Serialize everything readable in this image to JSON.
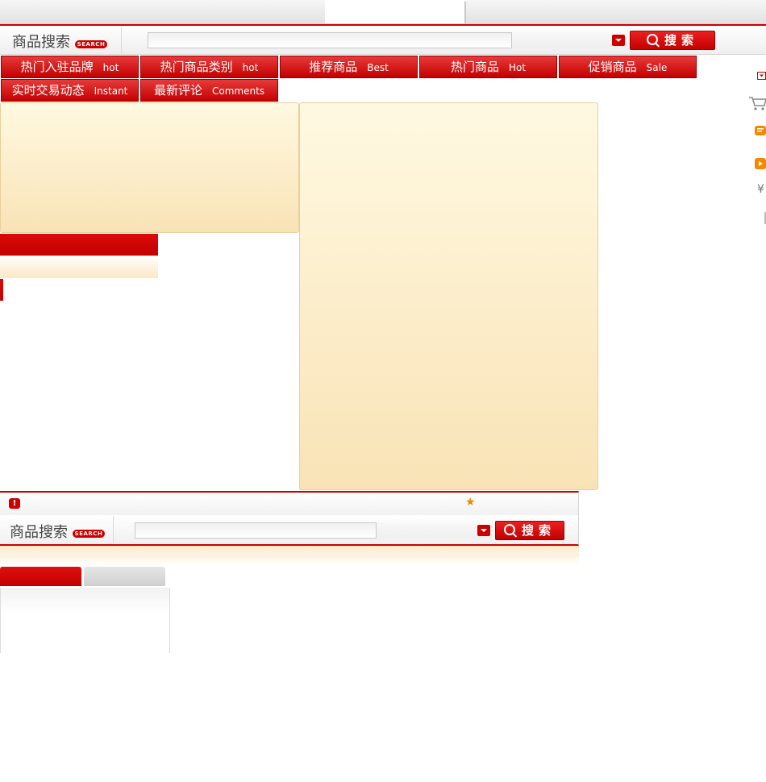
{
  "header": {
    "search_title": "商品搜索",
    "search_badge": "SEARCH",
    "search_placeholder": "",
    "search_button": "搜索"
  },
  "nav_tabs": [
    {
      "zh": "热门入驻品牌",
      "en": "hot"
    },
    {
      "zh": "热门商品类别",
      "en": "hot"
    },
    {
      "zh": "推荐商品",
      "en": "Best"
    },
    {
      "zh": "热门商品",
      "en": "Hot"
    },
    {
      "zh": "促销商品",
      "en": "Sale"
    },
    {
      "zh": "实时交易动态",
      "en": "Instant"
    },
    {
      "zh": "最新评论",
      "en": "Comments"
    }
  ],
  "side_icons": [
    "dropdown-icon",
    "cart-icon",
    "comment-icon",
    "play-icon",
    "yen-icon"
  ],
  "side_yen": "¥",
  "footer": {
    "search_title": "商品搜索",
    "search_badge": "SEARCH",
    "search_placeholder": "",
    "search_button": "搜索"
  },
  "colors": {
    "accent": "#cc0000",
    "cream_top": "#fff9e1",
    "cream_bottom": "#f9e3b6"
  }
}
